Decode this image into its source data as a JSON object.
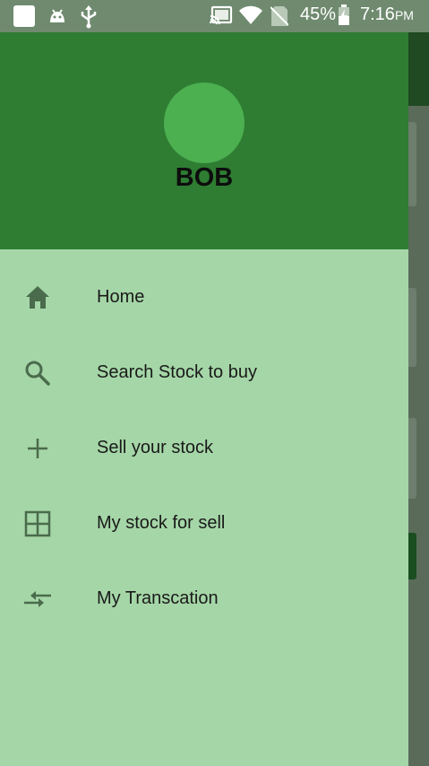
{
  "status_bar": {
    "battery": "45%",
    "time": "7:16",
    "ampm": "PM",
    "icons": [
      "square-icon",
      "android-icon",
      "usb-icon",
      "cast-icon",
      "wifi-icon",
      "no-sim-icon",
      "battery-icon"
    ]
  },
  "drawer": {
    "header": {
      "user_name": "BOB",
      "avatar_color": "#4caf50",
      "background_color": "#2e7d32"
    },
    "background_color": "#a5d6a7",
    "items": [
      {
        "label": "Home",
        "icon": "home-icon"
      },
      {
        "label": "Search Stock to buy",
        "icon": "search-icon"
      },
      {
        "label": "Sell your stock",
        "icon": "plus-icon"
      },
      {
        "label": "My stock for sell",
        "icon": "grid-icon"
      },
      {
        "label": "My Transcation",
        "icon": "swap-arrows-icon"
      }
    ]
  }
}
